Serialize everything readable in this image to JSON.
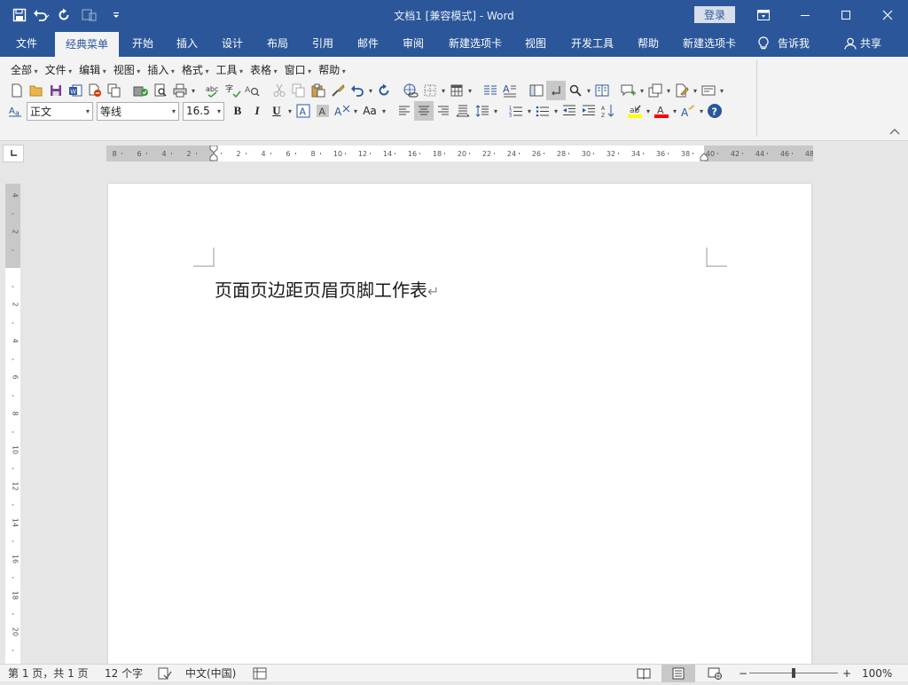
{
  "window": {
    "title": "文档1 [兼容模式]  -  Word",
    "login_label": "登录"
  },
  "tabs": [
    {
      "label": "文件"
    },
    {
      "label": "经典菜单"
    },
    {
      "label": "开始"
    },
    {
      "label": "插入"
    },
    {
      "label": "设计"
    },
    {
      "label": "布局"
    },
    {
      "label": "引用"
    },
    {
      "label": "邮件"
    },
    {
      "label": "审阅"
    },
    {
      "label": "新建选项卡"
    },
    {
      "label": "视图"
    },
    {
      "label": "开发工具"
    },
    {
      "label": "帮助"
    },
    {
      "label": "新建选项卡"
    },
    {
      "label": "告诉我"
    },
    {
      "label": "共享"
    }
  ],
  "classic_menu": [
    {
      "label": "全部"
    },
    {
      "label": "文件"
    },
    {
      "label": "编辑"
    },
    {
      "label": "视图"
    },
    {
      "label": "插入"
    },
    {
      "label": "格式"
    },
    {
      "label": "工具"
    },
    {
      "label": "表格"
    },
    {
      "label": "窗口"
    },
    {
      "label": "帮助"
    }
  ],
  "format": {
    "style": "正文",
    "font": "等线",
    "size": "16.5",
    "bold": "B",
    "italic": "I",
    "underline": "U",
    "change_case": "Aa"
  },
  "ruler": {
    "h_left": [
      "8",
      "6",
      "4",
      "2"
    ],
    "h_right": [
      "2",
      "4",
      "6",
      "8",
      "10",
      "12",
      "14",
      "16",
      "18",
      "20",
      "22",
      "24",
      "26",
      "28",
      "30",
      "32",
      "34",
      "36",
      "38",
      "40",
      "42",
      "44",
      "46",
      "48"
    ],
    "v_top": [
      "4",
      "2"
    ],
    "v_body": [
      "2",
      "4",
      "6",
      "8",
      "10",
      "12",
      "14",
      "16",
      "18",
      "20"
    ]
  },
  "document": {
    "text": "页面页边距页眉页脚工作表",
    "para_mark": "↵"
  },
  "status": {
    "page": "第 1 页，共 1 页",
    "words": "12 个字",
    "language": "中文(中国)",
    "zoom": "100%",
    "zoom_minus": "−",
    "zoom_plus": "+"
  },
  "colors": {
    "brand": "#2b579a",
    "highlight": "#ffff00",
    "font_color": "#ff0000"
  }
}
